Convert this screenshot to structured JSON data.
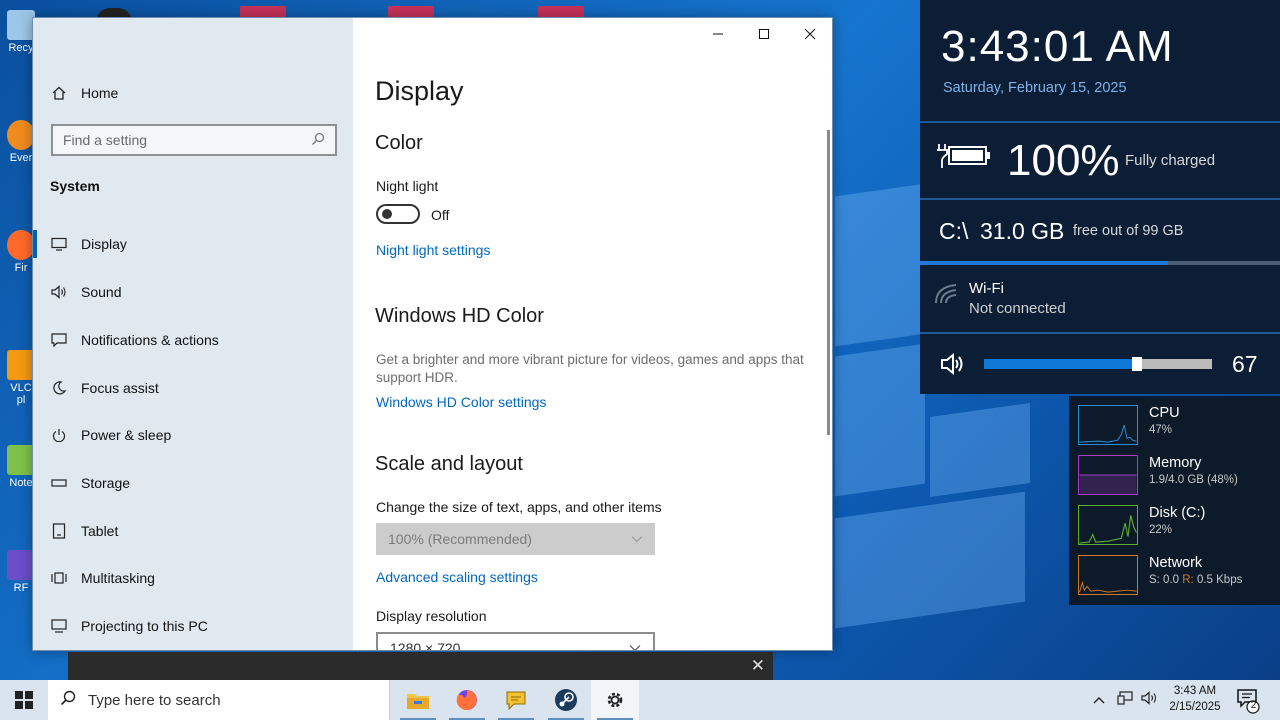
{
  "settings": {
    "nav": {
      "home": "Home",
      "search_placeholder": "Find a setting",
      "section": "System",
      "items": [
        {
          "label": "Display",
          "icon": "monitor-icon"
        },
        {
          "label": "Sound",
          "icon": "speaker-icon"
        },
        {
          "label": "Notifications & actions",
          "icon": "notification-icon"
        },
        {
          "label": "Focus assist",
          "icon": "moon-icon"
        },
        {
          "label": "Power & sleep",
          "icon": "power-icon"
        },
        {
          "label": "Storage",
          "icon": "storage-icon"
        },
        {
          "label": "Tablet",
          "icon": "tablet-icon"
        },
        {
          "label": "Multitasking",
          "icon": "multitasking-icon"
        },
        {
          "label": "Projecting to this PC",
          "icon": "projecting-icon"
        }
      ]
    },
    "page": {
      "title": "Display",
      "color_heading": "Color",
      "night_light_label": "Night light",
      "night_light_state": "Off",
      "night_light_link": "Night light settings",
      "hdr_heading": "Windows HD Color",
      "hdr_desc": "Get a brighter and more vibrant picture for videos, games and apps that support HDR.",
      "hdr_link": "Windows HD Color settings",
      "scale_heading": "Scale and layout",
      "scale_label": "Change the size of text, apps, and other items",
      "scale_value": "100% (Recommended)",
      "advanced_scaling_link": "Advanced scaling settings",
      "resolution_label": "Display resolution",
      "resolution_value": "1280 × 720"
    }
  },
  "widgets": {
    "time": "3:43:01 AM",
    "date": "Saturday, February 15, 2025",
    "battery_percent": "100%",
    "battery_status": "Fully charged",
    "disk_drive": "C:\\",
    "disk_free": "31.0 GB",
    "disk_sub": "free out of 99 GB",
    "disk_used_fraction": 0.69,
    "wifi_name": "Wi-Fi",
    "wifi_status": "Not connected",
    "volume": "67",
    "volume_level": 0.67,
    "perf": [
      {
        "name": "CPU",
        "value": "47%",
        "color": "#2b8fd6"
      },
      {
        "name": "Memory",
        "value": "1.9/4.0 GB (48%)",
        "color": "#a23cc2"
      },
      {
        "name": "Disk (C:)",
        "value": "22%",
        "color": "#5cae2e"
      },
      {
        "name": "Network",
        "value_prefix": "S: 0.0 ",
        "value_r": "R:",
        "value_suffix": " 0.5 Kbps",
        "color": "#d0781e"
      }
    ]
  },
  "desktop": {
    "icons": [
      "Recy",
      "Ever",
      "Fir",
      "VLC\npl",
      "Note",
      "RF"
    ]
  },
  "taskbar": {
    "search_placeholder": "Type here to search",
    "clock_time": "3:43 AM",
    "clock_date": "2/15/2025",
    "notification_count": "2"
  }
}
